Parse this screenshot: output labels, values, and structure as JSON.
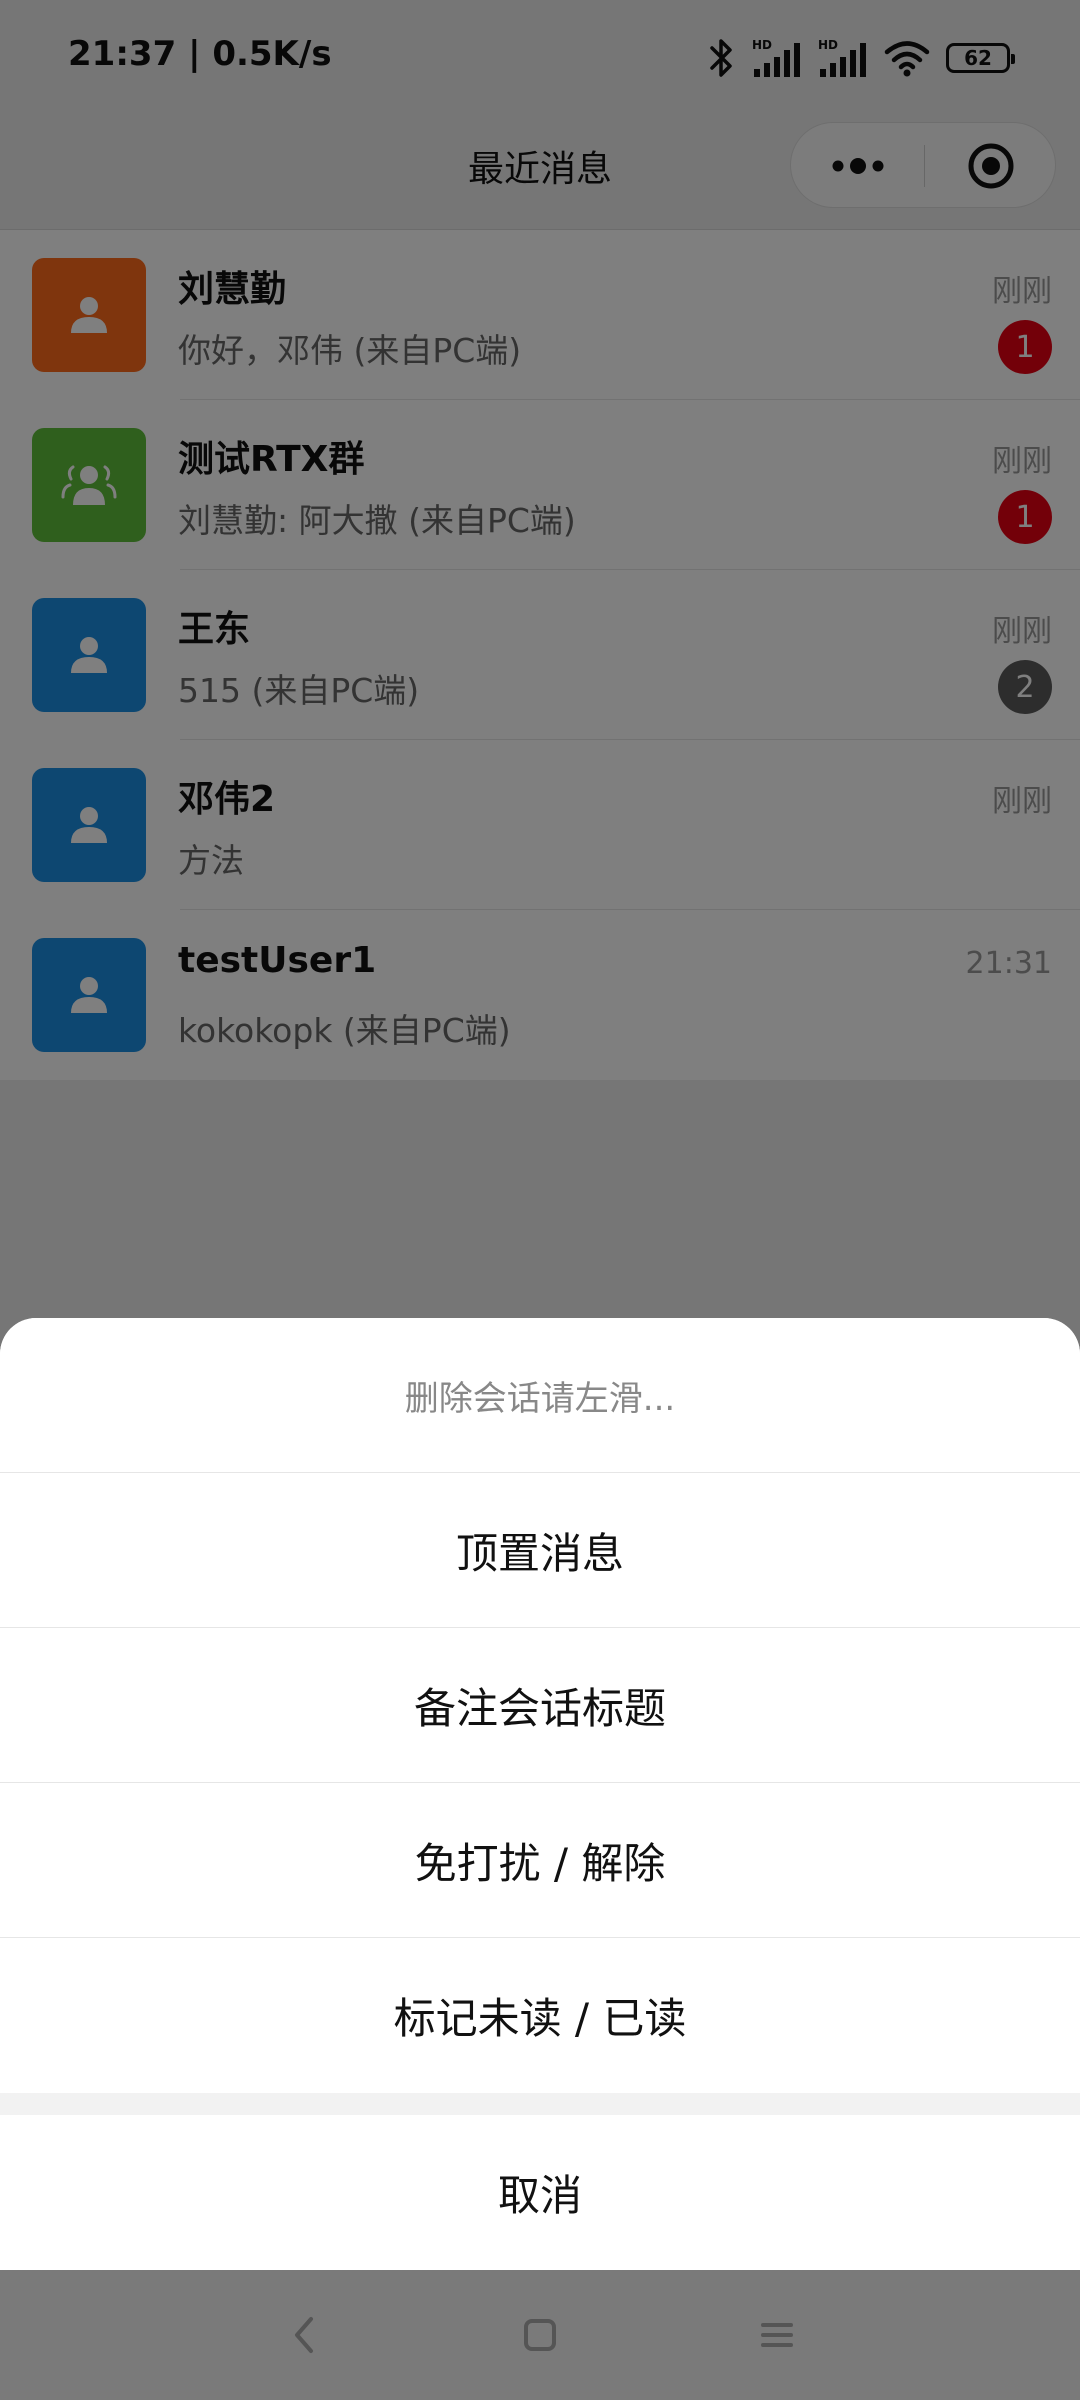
{
  "status_bar": {
    "time": "21:37 | 0.5K/s",
    "battery": "62"
  },
  "header": {
    "title": "最近消息"
  },
  "conversations": [
    {
      "name": "刘慧勤",
      "preview": "你好，邓伟 (来自PC端)",
      "time": "刚刚",
      "badge": "1",
      "badge_color": "#e60012",
      "avatar_color": "#ff6a1a",
      "avatar_icon": "person-icon"
    },
    {
      "name": "测试RTX群",
      "preview": "刘慧勤: 阿大撒 (来自PC端)",
      "time": "刚刚",
      "badge": "1",
      "badge_color": "#e60012",
      "avatar_color": "#5fbf3a",
      "avatar_icon": "group-icon"
    },
    {
      "name": "王东",
      "preview": "515 (来自PC端)",
      "time": "刚刚",
      "badge": "2",
      "badge_color": "#5a5a5a",
      "avatar_color": "#1a8fe3",
      "avatar_icon": "person-icon"
    },
    {
      "name": "邓伟2",
      "preview": "方法",
      "time": "刚刚",
      "badge": "",
      "avatar_color": "#1a8fe3",
      "avatar_icon": "person-icon"
    },
    {
      "name": "testUser1",
      "preview": "kokokopk (来自PC端)",
      "time": "21:31",
      "badge": "",
      "avatar_color": "#1a8fe3",
      "avatar_icon": "person-icon"
    }
  ],
  "action_sheet": {
    "hint": "删除会话请左滑...",
    "items": [
      "顶置消息",
      "备注会话标题",
      "免打扰 / 解除",
      "标记未读 / 已读"
    ],
    "cancel": "取消"
  }
}
